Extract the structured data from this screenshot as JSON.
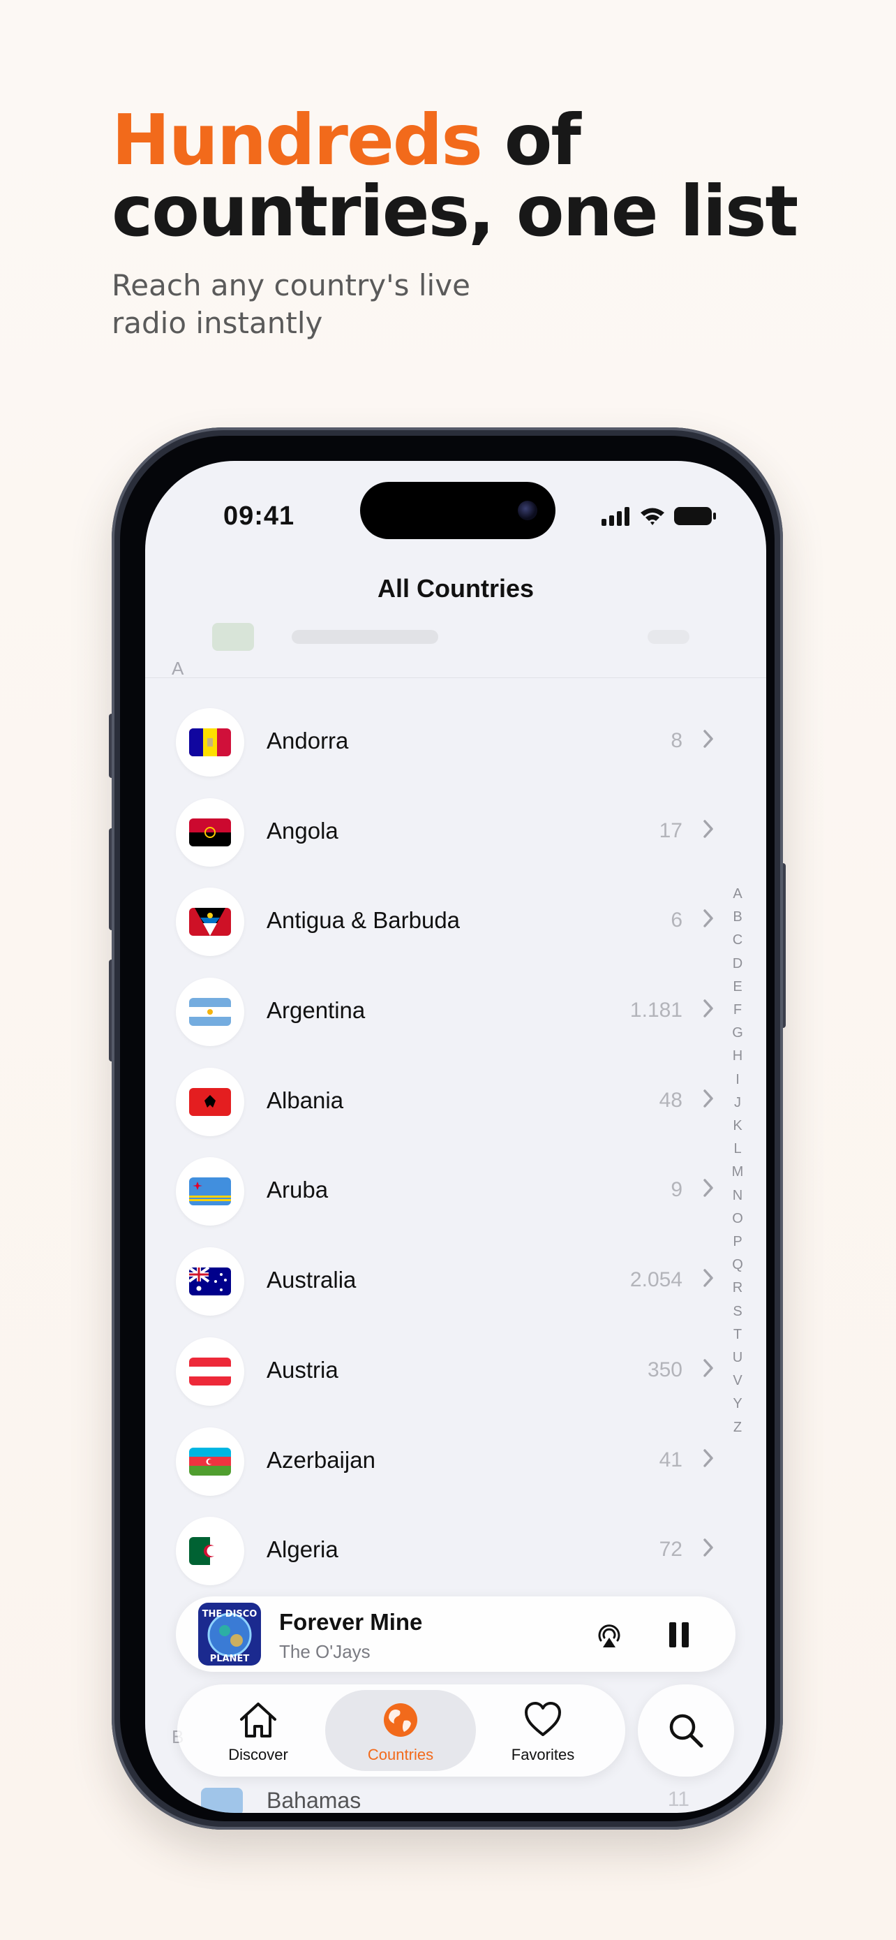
{
  "headline": {
    "accent": "Hundreds",
    "rest_line1": " of",
    "line2": "countries, one list"
  },
  "subhead": {
    "line1": "Reach any country's live",
    "line2": "radio instantly"
  },
  "status_bar": {
    "time": "09:41"
  },
  "nav": {
    "title": "All Countries",
    "section_a": "A",
    "section_b": "B"
  },
  "countries": [
    {
      "name": "Andorra",
      "count": "8",
      "flag": "🇦🇩"
    },
    {
      "name": "Angola",
      "count": "17",
      "flag": "🇦🇴"
    },
    {
      "name": "Antigua & Barbuda",
      "count": "6",
      "flag": "🇦🇬"
    },
    {
      "name": "Argentina",
      "count": "1.181",
      "flag": "🇦🇷"
    },
    {
      "name": "Albania",
      "count": "48",
      "flag": "🇦🇱"
    },
    {
      "name": "Aruba",
      "count": "9",
      "flag": "🇦🇼"
    },
    {
      "name": "Australia",
      "count": "2.054",
      "flag": "🇦🇺"
    },
    {
      "name": "Austria",
      "count": "350",
      "flag": "🇦🇹"
    },
    {
      "name": "Azerbaijan",
      "count": "41",
      "flag": "🇦🇿"
    },
    {
      "name": "Algeria",
      "count": "72",
      "flag": "🇩🇿"
    }
  ],
  "bottom_peek": {
    "name": "Bahamas",
    "count": "11"
  },
  "index_letters": [
    "A",
    "B",
    "C",
    "D",
    "E",
    "F",
    "G",
    "H",
    "I",
    "J",
    "K",
    "L",
    "M",
    "N",
    "O",
    "P",
    "Q",
    "R",
    "S",
    "T",
    "U",
    "V",
    "Y",
    "Z"
  ],
  "player": {
    "title": "Forever Mine",
    "artist": "The O'Jays",
    "artwork_text_top": "THE DISCO",
    "artwork_text_bottom": "PLANET"
  },
  "tabs": [
    {
      "label": "Discover",
      "icon": "house-icon"
    },
    {
      "label": "Countries",
      "icon": "globe-icon",
      "active": true
    },
    {
      "label": "Favorites",
      "icon": "heart-icon"
    }
  ],
  "colors": {
    "accent": "#f26a1b",
    "text": "#111111",
    "muted": "#b3b4ba"
  }
}
